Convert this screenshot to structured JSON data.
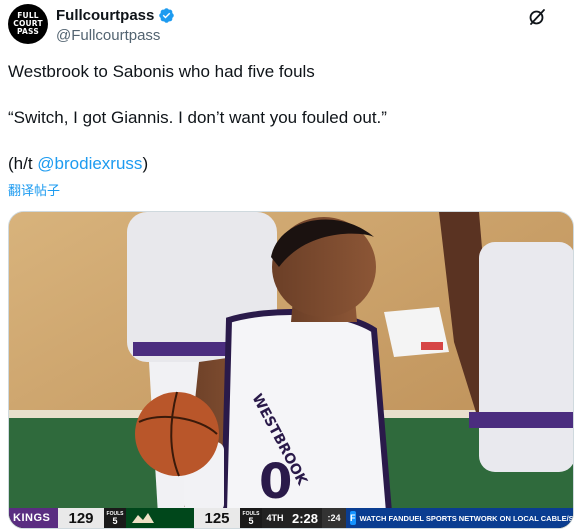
{
  "author": {
    "avatar_lines": [
      "FULL",
      "COURT",
      "PASS"
    ],
    "name": "Fullcourtpass",
    "handle": "@Fullcourtpass",
    "verified": true
  },
  "actions": {
    "more_icon": "grok-slash-icon"
  },
  "tweet": {
    "line1": "Westbrook to Sabonis who had five fouls",
    "line2": "“Switch, I got Giannis. I don’t want you fouled out.”",
    "line3_prefix": "(h/t ",
    "line3_mention": "@brodiexruss",
    "line3_suffix": ")",
    "translate": "翻译帖子"
  },
  "media": {
    "jersey_text": "WESTBROOK",
    "scorebug": {
      "home_team": "KINGS",
      "home_score": "129",
      "home_fouls_label": "FOULS",
      "home_fouls": "5",
      "away_score": "125",
      "away_fouls_label": "FOULS",
      "away_fouls": "5",
      "period": "4TH",
      "clock": "2:28",
      "shot_clock": ":24",
      "network_logo": "fanduel-logo",
      "watch_text": "WATCH FANDUEL SPORTS NETWORK ON LOCAL CABLE/SATELLITE"
    }
  },
  "colors": {
    "link": "#1d9bf0",
    "verified": "#1d9bf0",
    "kings_purple": "#5a2d81",
    "bucks_green": "#00471b"
  }
}
